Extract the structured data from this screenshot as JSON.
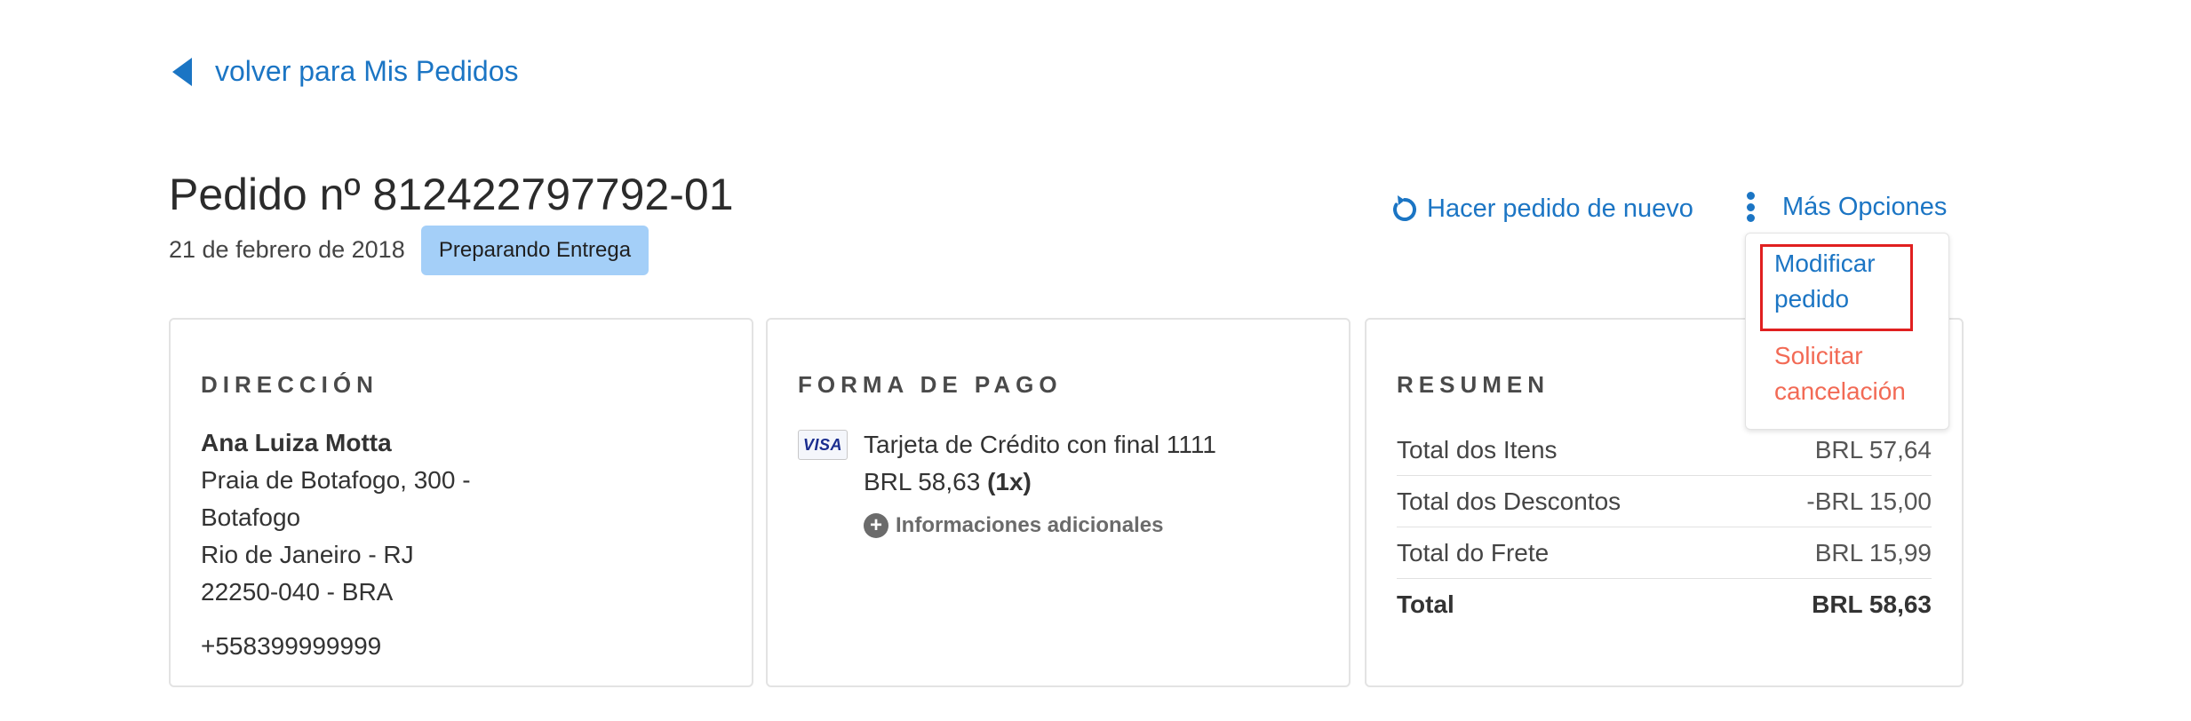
{
  "nav": {
    "back_label": "volver para Mis Pedidos"
  },
  "order": {
    "title": "Pedido nº 812422797792-01",
    "date": "21 de febrero de 2018",
    "status": "Preparando Entrega"
  },
  "actions": {
    "reorder_label": "Hacer pedido de nuevo",
    "more_options_label": "Más Opciones",
    "menu": {
      "modify_line1": "Modificar",
      "modify_line2": "pedido",
      "cancel_line1": "Solicitar",
      "cancel_line2": "cancelación"
    }
  },
  "address": {
    "heading": "DIRECCIÓN",
    "name": "Ana Luiza Motta",
    "line1": "Praia de Botafogo, 300 -",
    "line2": "Botafogo",
    "line3": "Rio de Janeiro - RJ",
    "line4": "22250-040 - BRA",
    "phone": "+558399999999"
  },
  "payment": {
    "heading": "FORMA DE PAGO",
    "card_brand": "VISA",
    "card_text": "Tarjeta de Crédito con final 1111",
    "amount": "BRL 58,63",
    "installments": "(1x)",
    "more_info_label": "Informaciones adicionales"
  },
  "summary": {
    "heading": "RESUMEN",
    "rows": [
      {
        "label": "Total dos Itens",
        "value": "BRL 57,64"
      },
      {
        "label": "Total dos Descontos",
        "value": "-BRL 15,00"
      },
      {
        "label": "Total do Frete",
        "value": "BRL 15,99"
      },
      {
        "label": "Total",
        "value": "BRL 58,63"
      }
    ]
  },
  "colors": {
    "link": "#1b75c4",
    "badge": "#a4cff8",
    "cancel": "#f26a55",
    "highlight_frame": "#e02020"
  },
  "icons": {
    "back": "caret-left-icon",
    "reorder": "refresh-icon",
    "more": "kebab-icon",
    "info": "plus-circle-icon",
    "card": "visa-icon"
  }
}
